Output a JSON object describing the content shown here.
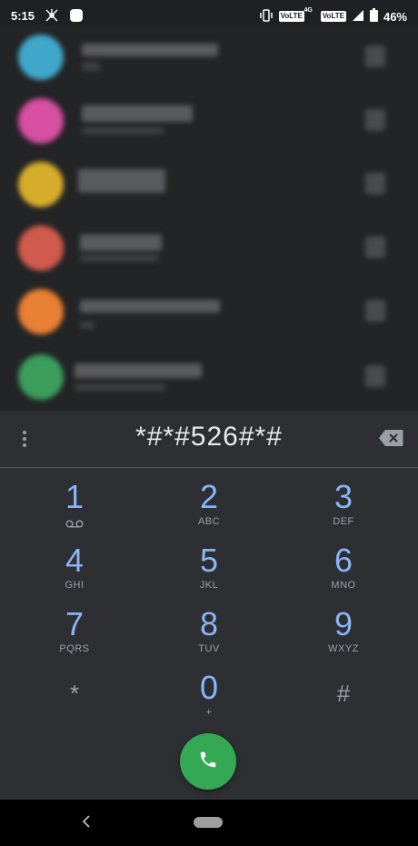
{
  "status_bar": {
    "time": "5:15",
    "volte1": "VoLTE",
    "volte1_sup": "4G",
    "volte2": "VoLTE",
    "battery": "46%"
  },
  "contacts": [
    {
      "avatar_color": "#3fa7c9"
    },
    {
      "avatar_color": "#d64fa0"
    },
    {
      "avatar_color": "#d6ad2a"
    },
    {
      "avatar_color": "#d05a4c"
    },
    {
      "avatar_color": "#e98033"
    },
    {
      "avatar_color": "#3b9e5c"
    }
  ],
  "dialpad": {
    "entered_digits": "*#*#526#*#",
    "keys": [
      {
        "num": "1",
        "letters": "voicemail-icon"
      },
      {
        "num": "2",
        "letters": "ABC"
      },
      {
        "num": "3",
        "letters": "DEF"
      },
      {
        "num": "4",
        "letters": "GHI"
      },
      {
        "num": "5",
        "letters": "JKL"
      },
      {
        "num": "6",
        "letters": "MNO"
      },
      {
        "num": "7",
        "letters": "PQRS"
      },
      {
        "num": "8",
        "letters": "TUV"
      },
      {
        "num": "9",
        "letters": "WXYZ"
      },
      {
        "num": "*",
        "letters": ""
      },
      {
        "num": "0",
        "letters": "+"
      },
      {
        "num": "#",
        "letters": ""
      }
    ]
  },
  "colors": {
    "accent_digit": "#8ab4f8",
    "call_button": "#34a853",
    "background": "#202124"
  }
}
